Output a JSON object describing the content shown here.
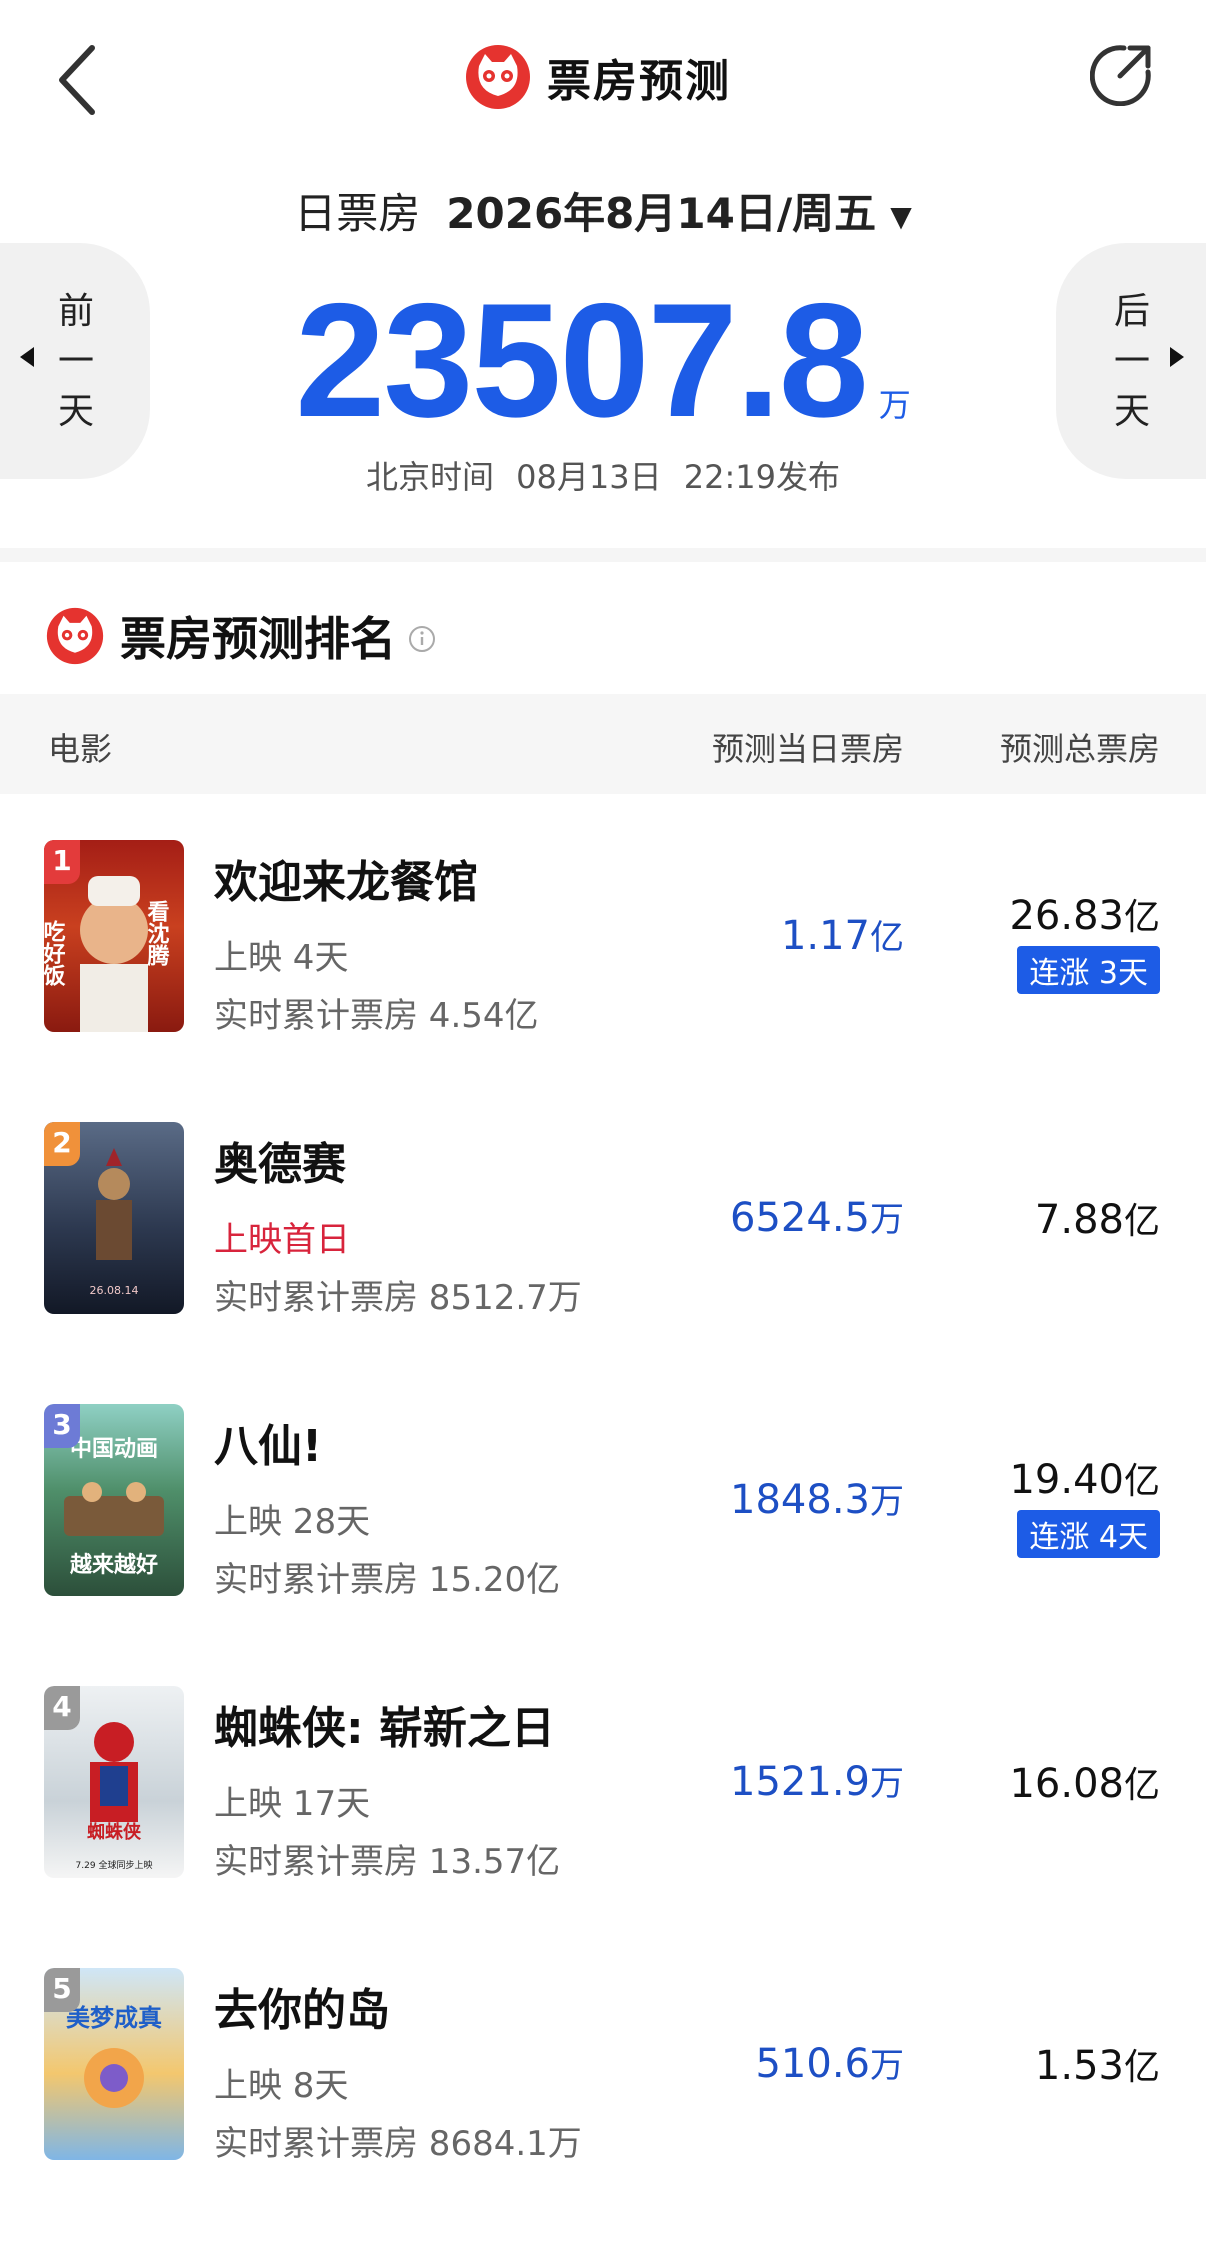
{
  "header": {
    "title": "票房预测"
  },
  "date_line": {
    "label": "日票房",
    "date": "2026年8月14日/周五"
  },
  "nav": {
    "prev": [
      "前",
      "一",
      "天"
    ],
    "next": [
      "后",
      "一",
      "天"
    ]
  },
  "total": {
    "value": "23507.8",
    "unit": "万"
  },
  "publish": {
    "prefix": "北京时间",
    "date": "08月13日",
    "time": "22:19发布"
  },
  "ranking": {
    "title": "票房预测排名"
  },
  "table": {
    "col_movie": "电影",
    "col_day": "预测当日票房",
    "col_total": "预测总票房"
  },
  "colors": {
    "accent": "#1d5ce6",
    "badge_red": "#e33b3b",
    "badge_orange": "#f0913a",
    "badge_purple": "#6d7bd6",
    "badge_grey": "#9a9a9a",
    "first_day_red": "#d8243c"
  },
  "movies": [
    {
      "rank": "1",
      "name": "欢迎来龙餐馆",
      "days": "上映 4天",
      "cumulative": "实时累计票房 4.54亿",
      "day_value": "1.17",
      "day_unit": "亿",
      "total_value": "26.83",
      "total_unit": "亿",
      "streak": "连涨 3天"
    },
    {
      "rank": "2",
      "name": "奥德赛",
      "days": "上映首日",
      "cumulative": "实时累计票房 8512.7万",
      "day_value": "6524.5",
      "day_unit": "万",
      "total_value": "7.88",
      "total_unit": "亿",
      "streak": ""
    },
    {
      "rank": "3",
      "name": "八仙!",
      "days": "上映 28天",
      "cumulative": "实时累计票房 15.20亿",
      "day_value": "1848.3",
      "day_unit": "万",
      "total_value": "19.40",
      "total_unit": "亿",
      "streak": "连涨 4天"
    },
    {
      "rank": "4",
      "name": "蜘蛛侠: 崭新之日",
      "days": "上映 17天",
      "cumulative": "实时累计票房 13.57亿",
      "day_value": "1521.9",
      "day_unit": "万",
      "total_value": "16.08",
      "total_unit": "亿",
      "streak": ""
    },
    {
      "rank": "5",
      "name": "去你的岛",
      "days": "上映 8天",
      "cumulative": "实时累计票房 8684.1万",
      "day_value": "510.6",
      "day_unit": "万",
      "total_value": "1.53",
      "total_unit": "亿",
      "streak": ""
    }
  ],
  "posters": [
    {
      "icon": "poster-welcome-dragon-restaurant",
      "text_left": "吃好饭",
      "text_right": "看沈腾"
    },
    {
      "icon": "poster-odyssey",
      "text": "26.08.14"
    },
    {
      "icon": "poster-eight-immortals",
      "text_top": "中国动画",
      "text_bottom": "越来越好"
    },
    {
      "icon": "poster-spider-man",
      "text": "蜘蛛侠",
      "date": "7.29 全球同步上映"
    },
    {
      "icon": "poster-go-to-your-island",
      "text": "美梦成真"
    }
  ]
}
